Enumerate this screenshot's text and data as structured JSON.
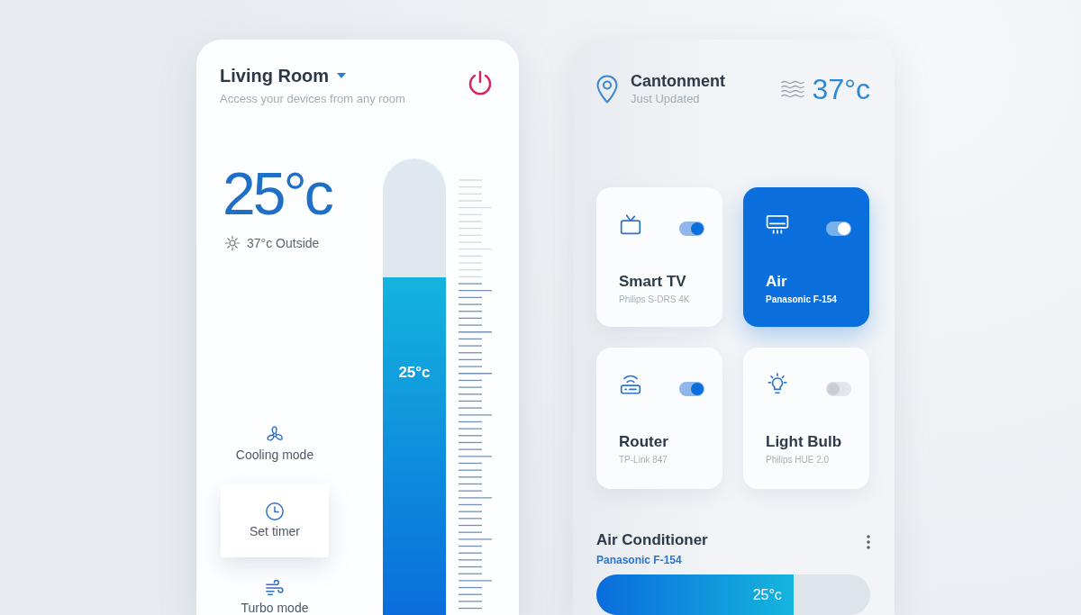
{
  "room_panel": {
    "title": "Living Room",
    "subtitle": "Access your devices from any room",
    "temperature": "25°c",
    "outside": "37°c Outside",
    "thermometer": {
      "level": 0.74,
      "reading": "25°c"
    },
    "modes": [
      {
        "kind": "fan",
        "label": "Cooling mode",
        "selected": false
      },
      {
        "kind": "timer",
        "label": "Set timer",
        "selected": true
      },
      {
        "kind": "wind",
        "label": "Turbo mode",
        "selected": false
      }
    ]
  },
  "location_panel": {
    "location": "Cantonment",
    "status": "Just Updated",
    "temperature": "37°c",
    "devices": [
      {
        "kind": "tv",
        "name": "Smart TV",
        "model": "Philips S-DRS 4K",
        "on": true,
        "selected": false
      },
      {
        "kind": "ac",
        "name": "Air",
        "model": "Panasonic F-154",
        "on": true,
        "selected": true
      },
      {
        "kind": "router",
        "name": "Router",
        "model": "TP-Link 847",
        "on": true,
        "selected": false
      },
      {
        "kind": "bulb",
        "name": "Light Bulb",
        "model": "Philips HUE 2.0",
        "on": false,
        "selected": false
      }
    ],
    "air_conditioner": {
      "title": "Air Conditioner",
      "model": "Panasonic F-154",
      "slider": {
        "level": 0.72,
        "reading": "25°c"
      }
    }
  }
}
